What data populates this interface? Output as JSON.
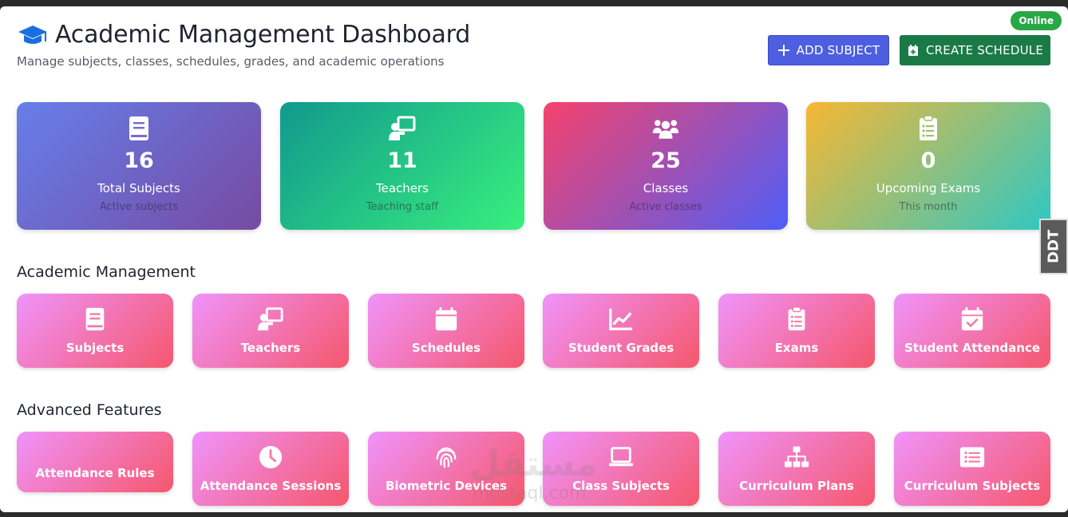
{
  "header": {
    "title": "Academic Management Dashboard",
    "subtitle": "Manage subjects, classes, schedules, grades, and academic operations",
    "status_badge": "Online",
    "add_subject_label": "ADD SUBJECT",
    "create_schedule_label": "CREATE SCHEDULE"
  },
  "stats": [
    {
      "value": "16",
      "label": "Total Subjects",
      "sub": "Active subjects",
      "icon": "book-icon"
    },
    {
      "value": "11",
      "label": "Teachers",
      "sub": "Teaching staff",
      "icon": "chalkboard-teacher-icon"
    },
    {
      "value": "25",
      "label": "Classes",
      "sub": "Active classes",
      "icon": "users-icon"
    },
    {
      "value": "0",
      "label": "Upcoming Exams",
      "sub": "This month",
      "icon": "clipboard-list-icon"
    }
  ],
  "academic": {
    "title": "Academic Management",
    "items": [
      {
        "label": "Subjects",
        "icon": "book-icon"
      },
      {
        "label": "Teachers",
        "icon": "chalkboard-teacher-icon"
      },
      {
        "label": "Schedules",
        "icon": "calendar-icon"
      },
      {
        "label": "Student Grades",
        "icon": "chart-line-icon"
      },
      {
        "label": "Exams",
        "icon": "clipboard-list-icon"
      },
      {
        "label": "Student Attendance",
        "icon": "calendar-check-icon"
      }
    ]
  },
  "advanced": {
    "title": "Advanced Features",
    "items": [
      {
        "label": "Attendance Rules",
        "icon": ""
      },
      {
        "label": "Attendance Sessions",
        "icon": "clock-icon"
      },
      {
        "label": "Biometric Devices",
        "icon": "fingerprint-icon"
      },
      {
        "label": "Class Subjects",
        "icon": "laptop-icon"
      },
      {
        "label": "Curriculum Plans",
        "icon": "sitemap-icon"
      },
      {
        "label": "Curriculum Subjects",
        "icon": "list-icon"
      }
    ]
  },
  "side_tab": "DDT",
  "watermark": {
    "arabic": "مستقل",
    "latin": "mostaql.com"
  }
}
